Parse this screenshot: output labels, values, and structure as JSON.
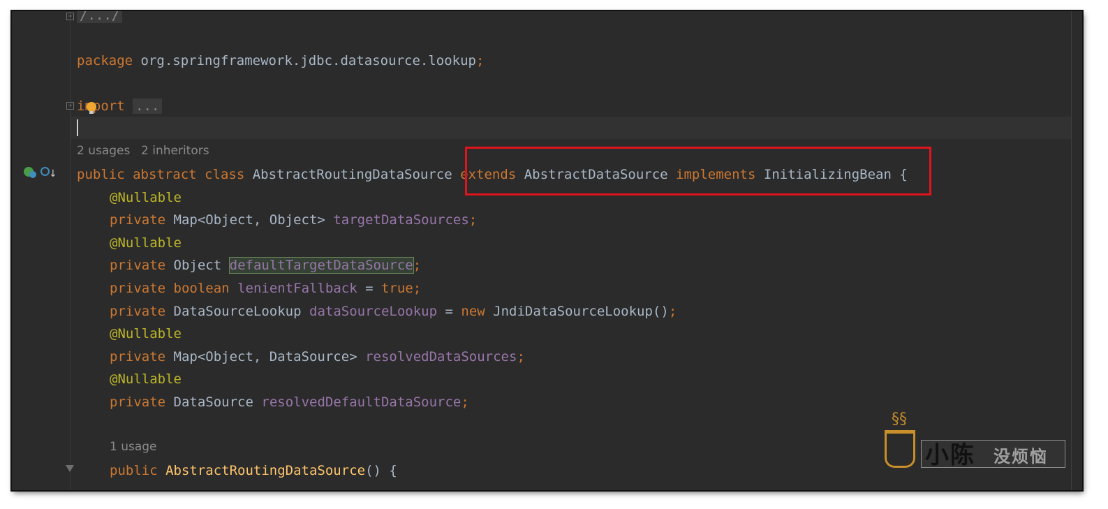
{
  "code": {
    "fold_top": "/.../",
    "package_kw": "package",
    "package_name": " org.springframework.jdbc.datasource.lookup",
    "semi": ";",
    "import_kw": "import",
    "import_folded": "...",
    "hint_usages": "2 usages",
    "hint_inheritors": "2 inheritors",
    "class_decl": {
      "public": "public",
      "abstract": "abstract",
      "class": "class",
      "name": "AbstractRoutingDataSource",
      "extends": "extends",
      "super": "AbstractDataSource",
      "implements": "implements",
      "iface": "InitializingBean",
      "brace": "{"
    },
    "annotation": "@Nullable",
    "private": "private",
    "field1": {
      "type": "Map<Object, Object>",
      "name": "targetDataSources"
    },
    "field2": {
      "type": "Object",
      "name": "defaultTargetDataSource"
    },
    "field3": {
      "type": "boolean",
      "name": "lenientFallback",
      "assign": " = ",
      "value": "true"
    },
    "field4": {
      "type": "DataSourceLookup",
      "name": "dataSourceLookup",
      "assign": " = ",
      "new": "new",
      "ctor": "JndiDataSourceLookup()"
    },
    "field5": {
      "type": "Map<Object, DataSource>",
      "name": "resolvedDataSources"
    },
    "field6": {
      "type": "DataSource",
      "name": "resolvedDefaultDataSource"
    },
    "hint_ctor_usage": "1 usage",
    "ctor_decl": {
      "public": "public",
      "name": "AbstractRoutingDataSource",
      "rest": "() {"
    }
  },
  "watermark": {
    "big": "小陈",
    "small": "没烦恼"
  },
  "colors": {
    "background": "#2b2b2b",
    "keyword": "#cc7832",
    "annotation": "#bbb529",
    "field": "#9876aa",
    "method": "#ffc66d",
    "text": "#a9b7c6",
    "highlight_box": "#e0141c"
  },
  "icons": [
    "fold-expand-icon",
    "intention-bulb-icon",
    "class-inheritance-icon",
    "implemented-interface-icon",
    "fold-collapse-icon",
    "coffee-cup-icon"
  ]
}
